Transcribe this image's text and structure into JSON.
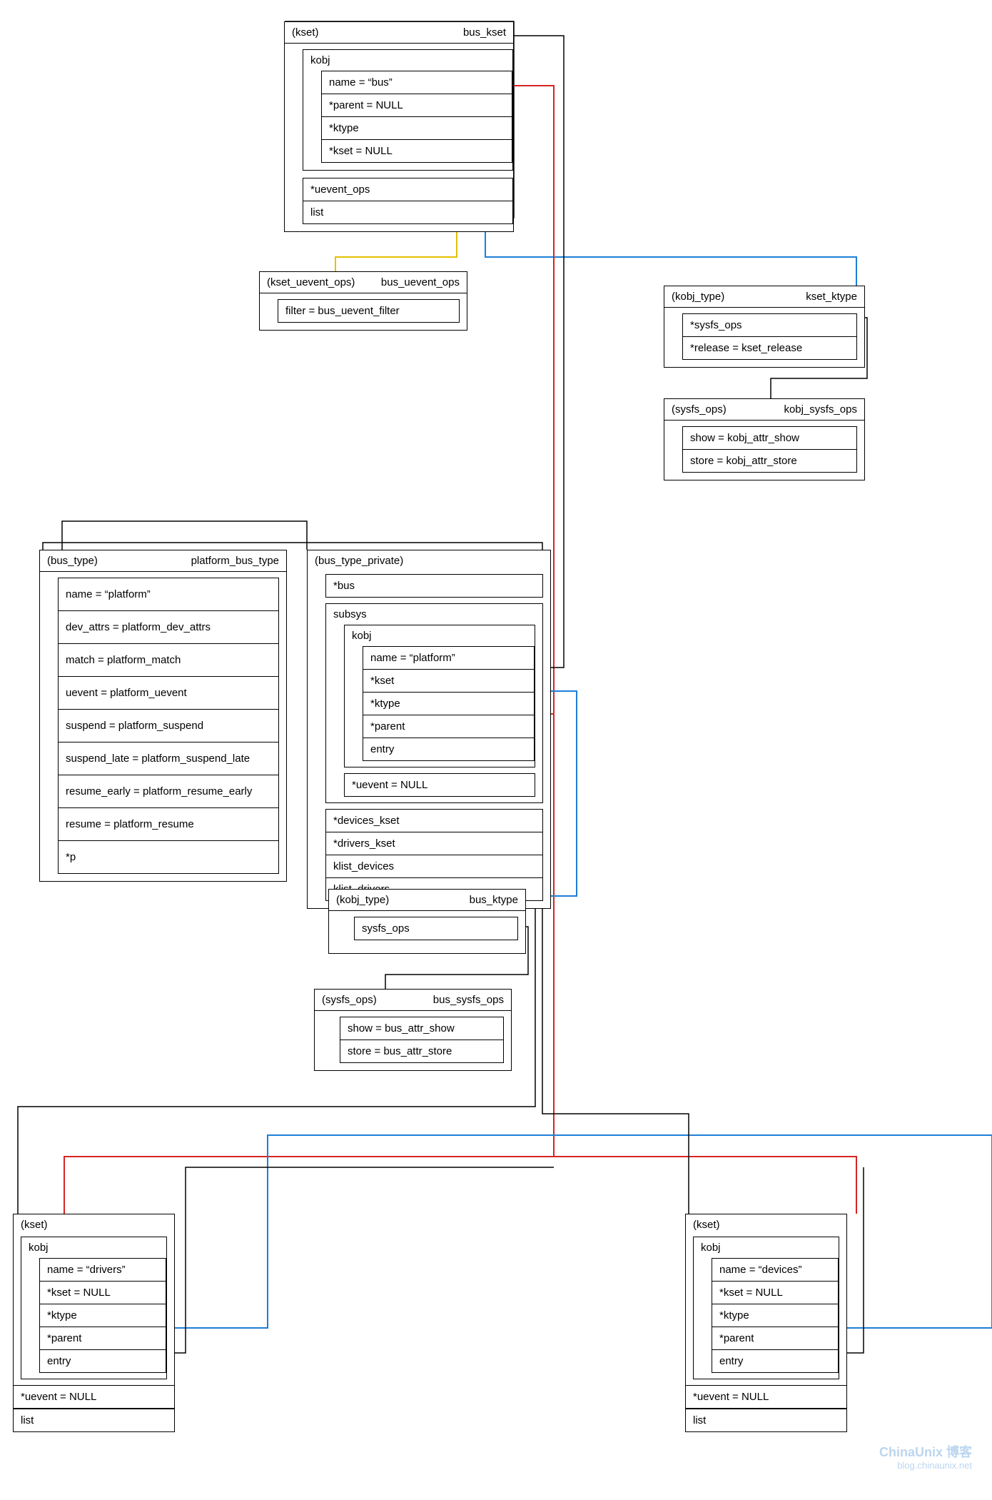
{
  "bus_kset": {
    "type": "(kset)",
    "name": "bus_kset",
    "kobj": {
      "label": "kobj",
      "fields": [
        "name = “bus”",
        "*parent = NULL",
        "*ktype",
        "*kset = NULL"
      ]
    },
    "tail": [
      "*uevent_ops",
      "list"
    ]
  },
  "bus_uevent_ops": {
    "type": "(kset_uevent_ops)",
    "name": "bus_uevent_ops",
    "fields": [
      "filter = bus_uevent_filter"
    ]
  },
  "kset_ktype": {
    "type": "(kobj_type)",
    "name": "kset_ktype",
    "fields": [
      "*sysfs_ops",
      "*release = kset_release"
    ]
  },
  "kobj_sysfs_ops": {
    "type": "(sysfs_ops)",
    "name": "kobj_sysfs_ops",
    "fields": [
      "show = kobj_attr_show",
      "store = kobj_attr_store"
    ]
  },
  "platform_bus_type": {
    "type": "(bus_type)",
    "name": "platform_bus_type",
    "fields": [
      "name = “platform”",
      "dev_attrs = platform_dev_attrs",
      "match = platform_match",
      "uevent = platform_uevent",
      "suspend = platform_suspend",
      "suspend_late = platform_suspend_late",
      "resume_early = platform_resume_early",
      "resume = platform_resume",
      "*p"
    ]
  },
  "bus_type_private": {
    "type": "(bus_type_private)",
    "bus_label": "*bus",
    "subsys": {
      "label": "subsys",
      "kobj": {
        "label": "kobj",
        "fields": [
          "name = “platform”",
          "*kset",
          "*ktype",
          "*parent",
          "entry"
        ]
      },
      "tail": [
        "*uevent = NULL"
      ]
    },
    "tail": [
      "*devices_kset",
      "*drivers_kset",
      "klist_devices",
      "klist_drivers"
    ]
  },
  "bus_ktype": {
    "type": "(kobj_type)",
    "name": "bus_ktype",
    "fields": [
      "sysfs_ops"
    ]
  },
  "bus_sysfs_ops": {
    "type": "(sysfs_ops)",
    "name": "bus_sysfs_ops",
    "fields": [
      "show = bus_attr_show",
      "store = bus_attr_store"
    ]
  },
  "drivers_kset": {
    "type": "(kset)",
    "kobj": {
      "label": "kobj",
      "fields": [
        "name = “drivers”",
        "*kset = NULL",
        "*ktype",
        "*parent",
        "entry"
      ]
    },
    "tail": [
      "*uevent = NULL",
      "list"
    ]
  },
  "devices_kset": {
    "type": "(kset)",
    "kobj": {
      "label": "kobj",
      "fields": [
        "name = “devices”",
        "*kset = NULL",
        "*ktype",
        "*parent",
        "entry"
      ]
    },
    "tail": [
      "*uevent = NULL",
      "list"
    ]
  },
  "watermark": {
    "line1": "ChinaUnix 博客",
    "line2": "blog.chinaunix.net"
  }
}
